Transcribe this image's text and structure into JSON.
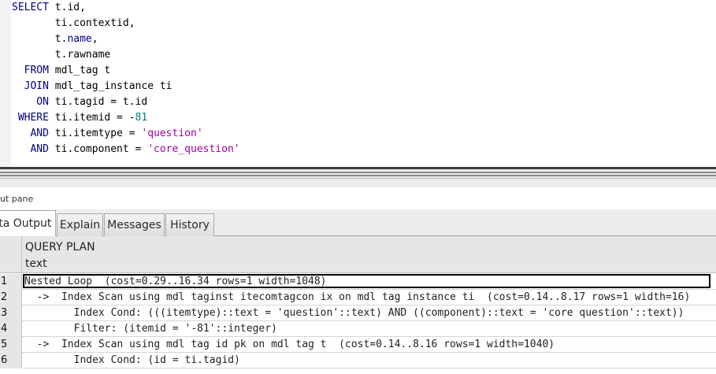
{
  "editor": {
    "lines": [
      [
        {
          "t": "SELECT",
          "c": "kw"
        },
        {
          "t": " t.id,",
          "c": ""
        }
      ],
      [
        {
          "t": "       ti.contextid,",
          "c": ""
        }
      ],
      [
        {
          "t": "       t.",
          "c": ""
        },
        {
          "t": "name",
          "c": "fn"
        },
        {
          "t": ",",
          "c": ""
        }
      ],
      [
        {
          "t": "       t.rawname",
          "c": ""
        }
      ],
      [
        {
          "t": "  FROM",
          "c": "kw"
        },
        {
          "t": " mdl_tag t",
          "c": ""
        }
      ],
      [
        {
          "t": "  JOIN",
          "c": "kw"
        },
        {
          "t": " mdl_tag_instance ti",
          "c": ""
        }
      ],
      [
        {
          "t": "    ON",
          "c": "kw"
        },
        {
          "t": " ti.tagid = t.id",
          "c": ""
        }
      ],
      [
        {
          "t": " WHERE",
          "c": "kw"
        },
        {
          "t": " ti.itemid = -",
          "c": ""
        },
        {
          "t": "81",
          "c": "num"
        }
      ],
      [
        {
          "t": "   AND",
          "c": "kw"
        },
        {
          "t": " ti.itemtype = ",
          "c": ""
        },
        {
          "t": "'question'",
          "c": "str"
        }
      ],
      [
        {
          "t": "   AND",
          "c": "kw"
        },
        {
          "t": " ti.component = ",
          "c": ""
        },
        {
          "t": "'core_question'",
          "c": "str"
        }
      ]
    ]
  },
  "output_pane": {
    "label": "ut pane"
  },
  "tabs": [
    {
      "label": "ata Output",
      "active": true
    },
    {
      "label": "Explain",
      "active": false
    },
    {
      "label": "Messages",
      "active": false
    },
    {
      "label": "History",
      "active": false
    }
  ],
  "grid": {
    "column": {
      "name": "QUERY PLAN",
      "type": "text"
    },
    "rows": [
      {
        "num": "1",
        "value": "Nested Loop  (cost=0.29..16.34 rows=1 width=1048)",
        "selected": true
      },
      {
        "num": "2",
        "value": "  ->  Index Scan using mdl taginst itecomtagcon ix on mdl tag instance ti  (cost=0.14..8.17 rows=1 width=16)",
        "selected": false
      },
      {
        "num": "3",
        "value": "        Index Cond: (((itemtype)::text = 'question'::text) AND ((component)::text = 'core question'::text))",
        "selected": false
      },
      {
        "num": "4",
        "value": "        Filter: (itemid = '-81'::integer)",
        "selected": false
      },
      {
        "num": "5",
        "value": "  ->  Index Scan using mdl tag id pk on mdl tag t  (cost=0.14..8.16 rows=1 width=1040)",
        "selected": false
      },
      {
        "num": "6",
        "value": "        Index Cond: (id = ti.tagid)",
        "selected": false
      }
    ]
  }
}
